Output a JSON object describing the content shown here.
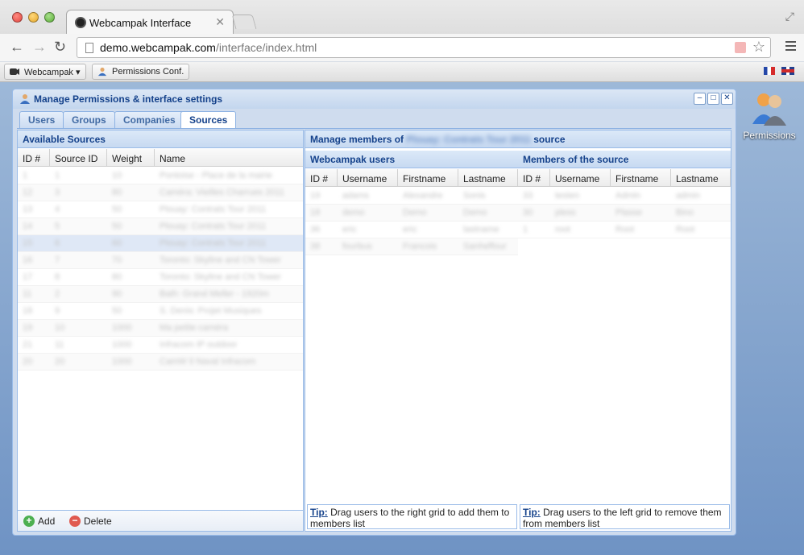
{
  "browser": {
    "tab_title": "Webcampak Interface",
    "url_domain": "demo.webcampak.com",
    "url_path": "/interface/index.html"
  },
  "app_toolbar": {
    "menu_label": "Webcampak",
    "permissions_label": "Permissions Conf."
  },
  "desktop": {
    "permissions_icon_label": "Permissions"
  },
  "window": {
    "title": "Manage Permissions & interface settings",
    "tabs": [
      "Users",
      "Groups",
      "Companies",
      "Sources"
    ],
    "active_tab": "Sources"
  },
  "available_sources": {
    "title": "Available Sources",
    "columns": [
      "ID #",
      "Source ID",
      "Weight",
      "Name"
    ],
    "rows": [
      [
        "1",
        "1",
        "10",
        "Pontoise - Place de la mairie"
      ],
      [
        "12",
        "3",
        "80",
        "Caméra: Vieilles Charrues 2011"
      ],
      [
        "13",
        "4",
        "50",
        "Plouay: Contrats Tour 2011"
      ],
      [
        "14",
        "5",
        "50",
        "Plouay: Contrats Tour 2011"
      ],
      [
        "15",
        "6",
        "60",
        "Plouay: Contrats Tour 2011"
      ],
      [
        "16",
        "7",
        "70",
        "Toronto: Skyline and CN Tower"
      ],
      [
        "17",
        "8",
        "80",
        "Toronto: Skyline and CN Tower"
      ],
      [
        "11",
        "2",
        "90",
        "Bath: Grand Meller - 1920m"
      ],
      [
        "18",
        "9",
        "50",
        "S. Denis: Projet Musiques"
      ],
      [
        "19",
        "10",
        "1000",
        "Ma petite caméra"
      ],
      [
        "21",
        "11",
        "1000",
        "Infracom IP outdoor"
      ],
      [
        "20",
        "20",
        "1000",
        "CamW Il Naval Infracom"
      ]
    ],
    "selected_row": 4,
    "add_label": "Add",
    "delete_label": "Delete"
  },
  "manage_members": {
    "title_prefix": "Manage members of",
    "title_source": "Plouay: Contrats Tour 2011",
    "title_suffix": "source"
  },
  "webcampak_users": {
    "title": "Webcampak users",
    "columns": [
      "ID #",
      "Username",
      "Firstname",
      "Lastname"
    ],
    "rows": [
      [
        "19",
        "adams",
        "Alexandre",
        "Sonis"
      ],
      [
        "18",
        "demo",
        "Demo",
        "Demo"
      ],
      [
        "36",
        "eric",
        "eric",
        "lastname"
      ],
      [
        "38",
        "fourbus",
        "Francois",
        "Sanheffour"
      ]
    ],
    "tip_label": "Tip:",
    "tip_text": "Drag users to the right grid to add them to members list"
  },
  "members_of_source": {
    "title": "Members of the source",
    "columns": [
      "ID #",
      "Username",
      "Firstname",
      "Lastname"
    ],
    "rows": [
      [
        "33",
        "testen",
        "Admin",
        "admin"
      ],
      [
        "30",
        "pless",
        "Plasse",
        "Bino"
      ],
      [
        "1",
        "root",
        "Root",
        "Root"
      ]
    ],
    "tip_label": "Tip:",
    "tip_text": "Drag users to the left grid to remove them from members list"
  },
  "colors": {
    "header_text": "#15428b",
    "panel_border": "#99bbe8",
    "selected_row": "#dfe8f6"
  }
}
